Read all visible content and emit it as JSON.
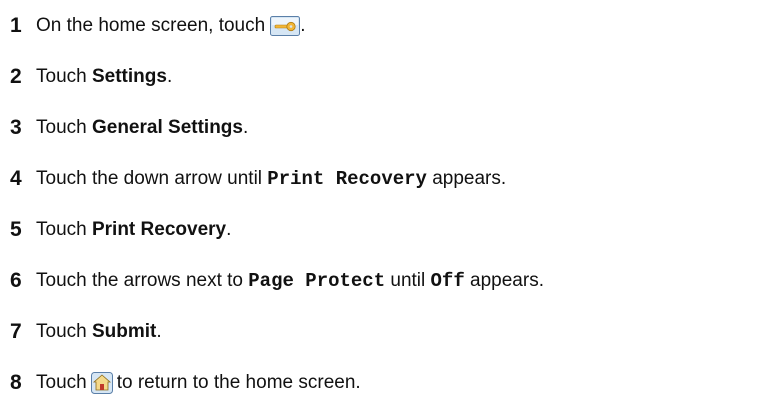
{
  "steps": [
    {
      "number": "1",
      "prefix": "On the home screen, touch",
      "icon": "settings-key-icon",
      "suffix": "."
    },
    {
      "number": "2",
      "prefix": "Touch ",
      "bold": "Settings",
      "suffix": "."
    },
    {
      "number": "3",
      "prefix": "Touch ",
      "bold": "General Settings",
      "suffix": "."
    },
    {
      "number": "4",
      "prefix": "Touch the down arrow until ",
      "mono": "Print Recovery",
      "suffix": " appears."
    },
    {
      "number": "5",
      "prefix": "Touch ",
      "bold": "Print Recovery",
      "suffix": "."
    },
    {
      "number": "6",
      "prefix": "Touch the arrows next to ",
      "mono": "Page Protect",
      "middle": " until ",
      "mono2": "Off",
      "suffix": " appears."
    },
    {
      "number": "7",
      "prefix": "Touch ",
      "bold": "Submit",
      "suffix": "."
    },
    {
      "number": "8",
      "prefix": "Touch",
      "icon": "home-icon",
      "suffix": "to return to the home screen."
    }
  ],
  "colors": {
    "key_icon_fill": "#d6e6f4",
    "key_icon_border": "#5a7fa8",
    "key_color": "#f2b636",
    "home_icon_fill": "#f4d98a"
  }
}
